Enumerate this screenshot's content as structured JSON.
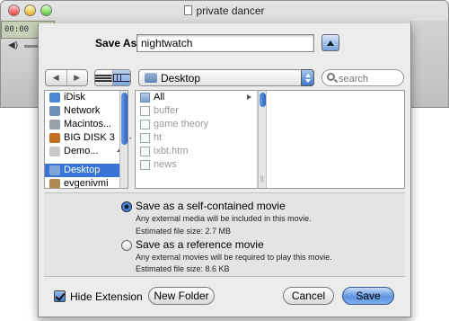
{
  "window": {
    "title": "private dancer",
    "time_display": "00:00"
  },
  "save_as": {
    "label": "Save As:",
    "value": "nightwatch"
  },
  "location": {
    "selected": "Desktop"
  },
  "search": {
    "placeholder": "search"
  },
  "sidebar": {
    "items": [
      {
        "label": "iDisk",
        "icon": "idisk-icon",
        "color": "#4a86d8"
      },
      {
        "label": "Network",
        "icon": "network-icon",
        "color": "#6a8fb8"
      },
      {
        "label": "Macintos...",
        "icon": "hard-disk-icon",
        "color": "#9aa0a8"
      },
      {
        "label": "BIG DISK 3",
        "icon": "external-disk-icon",
        "color": "#c07020"
      },
      {
        "label": "Demo...",
        "icon": "disk-icon",
        "color": "#c8c8c8",
        "eject": true
      },
      {
        "label": "",
        "icon": "",
        "color": ""
      },
      {
        "label": "Desktop",
        "icon": "desktop-icon",
        "color": "#7fa6d6",
        "selected": true
      },
      {
        "label": "evgenivmi",
        "icon": "home-icon",
        "color": "#b08a50"
      }
    ]
  },
  "browser": {
    "column1": [
      {
        "label": "All",
        "icon": "folder-icon",
        "strong": true,
        "disclosure": true
      },
      {
        "label": "buffer",
        "icon": "file-icon"
      },
      {
        "label": "game theory",
        "icon": "file-icon"
      },
      {
        "label": "ht",
        "icon": "file-icon"
      },
      {
        "label": "ixbt.htm",
        "icon": "file-icon"
      },
      {
        "label": "news",
        "icon": "file-icon"
      }
    ]
  },
  "options": {
    "self_contained": {
      "title": "Save as a self-contained movie",
      "line1": "Any external media will be included in this movie.",
      "line2": "Estimated file size:  2.7 MB",
      "selected": true
    },
    "reference": {
      "title": "Save as a reference movie",
      "line1": "Any external movies will be required to play this movie.",
      "line2": "Estimated file size:  8.6 KB",
      "selected": false
    }
  },
  "footer": {
    "hide_extension_label": "Hide Extension",
    "hide_extension_checked": true,
    "new_folder_label": "New Folder",
    "cancel_label": "Cancel",
    "save_label": "Save"
  }
}
